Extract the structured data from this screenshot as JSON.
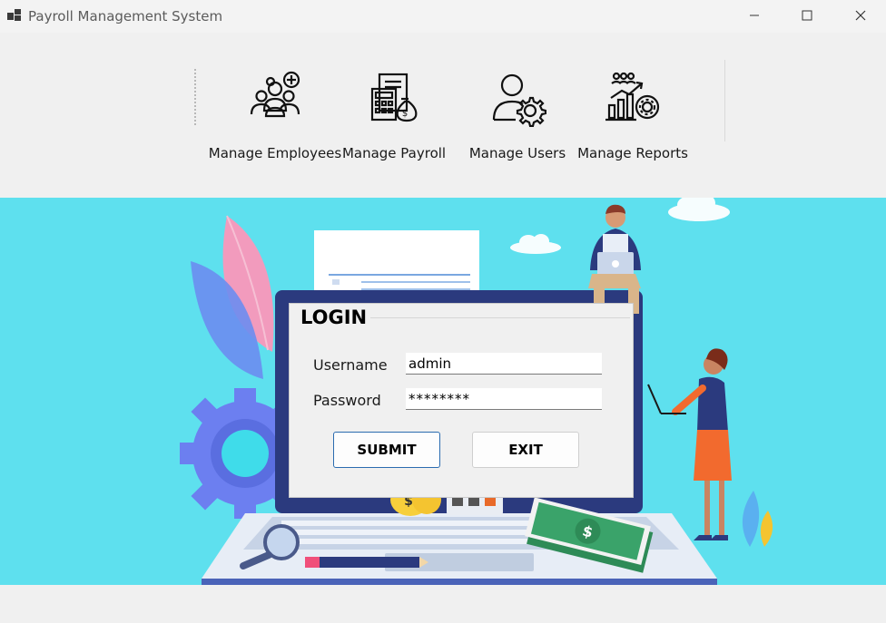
{
  "window": {
    "title": "Payroll Management System",
    "controls": [
      "minimize",
      "maximize",
      "close"
    ]
  },
  "toolbar": {
    "items": [
      {
        "label": "Manage Employees",
        "icon": "group-add-icon"
      },
      {
        "label": "Manage Payroll",
        "icon": "calculator-money-icon"
      },
      {
        "label": "Manage Users",
        "icon": "user-gear-icon"
      },
      {
        "label": "Manage Reports",
        "icon": "report-chart-icon"
      }
    ]
  },
  "login": {
    "title": "LOGIN",
    "username_label": "Username",
    "username_value": "admin",
    "password_label": "Password",
    "password_value": "********",
    "submit_label": "SUBMIT",
    "exit_label": "EXIT"
  },
  "colors": {
    "scene_background": "#5ee0ee",
    "laptop_frame": "#2b3a7e",
    "submit_border": "#2b6cb0"
  }
}
